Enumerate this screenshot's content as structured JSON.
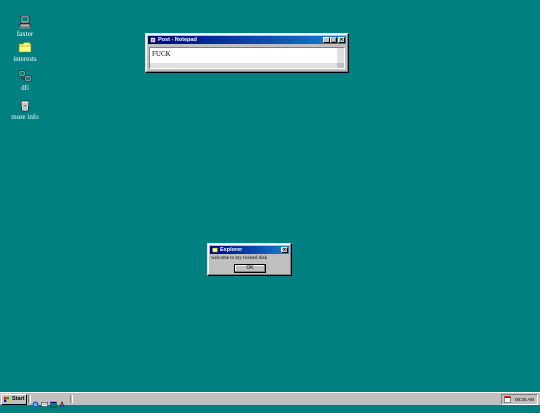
{
  "desktop": {
    "background": "#008080",
    "icons": [
      {
        "label": "faxter",
        "icon": "computer-icon"
      },
      {
        "label": "interests",
        "icon": "folder-icon"
      },
      {
        "label": "dfi",
        "icon": "network-icon"
      },
      {
        "label": "more info",
        "icon": "recycle-bin-icon"
      }
    ]
  },
  "notepad": {
    "title": "Post - Notepad",
    "content": "FUCK",
    "controls": [
      "_",
      "□",
      "×"
    ]
  },
  "dialog": {
    "title": "Explorer",
    "message": "welcome to my twisted disk",
    "ok_label": "OK",
    "close": "×"
  },
  "taskbar": {
    "start_label": "Start",
    "quick_launch": [
      "ie-icon",
      "outlook-icon",
      "desktop-icon",
      "channel-icon"
    ],
    "clock": "09:25 AM"
  },
  "colors": {
    "title_active_start": "#000080",
    "title_active_end": "#1084d0",
    "face": "#c0c0c0"
  }
}
